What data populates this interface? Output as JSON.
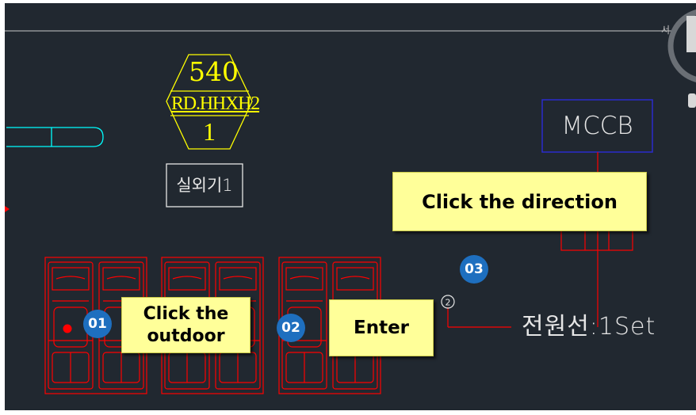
{
  "drawing": {
    "unit_tag": {
      "capacity": "540",
      "model": "RD.HHXH2",
      "quantity": "1"
    },
    "unit_name_label": "실외기1",
    "breaker_label": "MCCB",
    "cable_label": "전원선:1Set",
    "cable_bubble_number": "2",
    "viewcube_letter": "서"
  },
  "steps": [
    {
      "number": "01",
      "caption_line1": "Click the",
      "caption_line2": "outdoor"
    },
    {
      "number": "02",
      "caption": "Enter"
    },
    {
      "number": "03",
      "caption": "Click the direction"
    }
  ],
  "colors": {
    "canvas_bg": "#212830",
    "cad_red": "#ff0000",
    "cad_yellow": "#ffff00",
    "cad_white": "#f0f0f0",
    "cad_blue": "#2b2bcc",
    "cad_cyan": "#00ffff",
    "callout_bg": "#ffff99",
    "badge_bg": "#1e6fbf"
  }
}
